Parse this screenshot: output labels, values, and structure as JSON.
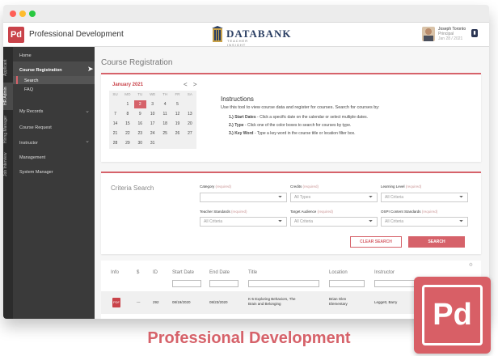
{
  "app": {
    "logo": "Pd",
    "title": "Professional Development",
    "brand": "DATABANK",
    "brand_sub": "TEACHER INSIGHT",
    "user_name": "Joseph Toronto",
    "user_role": "Principal",
    "user_sub": "Jan 28 / 2021"
  },
  "vtabs": [
    "Applicant",
    "HR Admin",
    "Hiring Manager",
    "Job Interview"
  ],
  "sidebar": {
    "items": [
      {
        "label": "Home"
      },
      {
        "label": "Course Registration"
      },
      {
        "label": "Search"
      },
      {
        "label": "FAQ"
      },
      {
        "label": "My Records"
      },
      {
        "label": "Course Request"
      },
      {
        "label": "Instructor"
      },
      {
        "label": "Management"
      },
      {
        "label": "System Manager"
      }
    ]
  },
  "main": {
    "page_title": "Course Registration",
    "calendar": {
      "month": "January 2021",
      "prev": "<",
      "next": ">",
      "days": [
        "SU",
        "MO",
        "TU",
        "WE",
        "TH",
        "FR",
        "SA"
      ],
      "weeks": [
        [
          "",
          "1",
          "2",
          "3",
          "4",
          "5",
          ""
        ],
        [
          "7",
          "8",
          "9",
          "10",
          "11",
          "12",
          "13"
        ],
        [
          "14",
          "15",
          "16",
          "17",
          "18",
          "19",
          "20"
        ],
        [
          "21",
          "22",
          "23",
          "24",
          "25",
          "26",
          "27"
        ],
        [
          "28",
          "29",
          "30",
          "31",
          "",
          "",
          ""
        ]
      ],
      "selected": "2"
    },
    "instructions": {
      "title": "Instructions",
      "text": "Use this tool to view course data and register for courses. Search for courses by:",
      "steps": [
        {
          "bold": "1.) Start Dates",
          "text": " - Click a specific date on the calendar or select multiple dates."
        },
        {
          "bold": "2.) Type",
          "text": " - Click one of the color boxes to search for courses by type."
        },
        {
          "bold": "3.) Key Word",
          "text": " - Type a key word in the course title or location filter box."
        }
      ]
    },
    "criteria": {
      "title": "Criteria Search",
      "fields": [
        {
          "label": "Category",
          "req": "(required)",
          "value": ""
        },
        {
          "label": "Credits",
          "req": "(required)",
          "value": "All Types"
        },
        {
          "label": "Learning Level",
          "req": "(required)",
          "value": "All Criteria"
        },
        {
          "label": "Teacher Standards",
          "req": "(required)",
          "value": "All Criteria"
        },
        {
          "label": "Target Audience",
          "req": "(required)",
          "value": "All Criteria"
        },
        {
          "label": "OSPI Content Standards",
          "req": "(required)",
          "value": "All Criteria"
        }
      ],
      "clear_label": "CLEAR SEARCH",
      "search_label": "SEARCH"
    },
    "table": {
      "headers": [
        "Info",
        "$",
        "ID",
        "Start Date",
        "End Date",
        "Title",
        "Location",
        "Instructor"
      ],
      "rows": [
        {
          "info": "PDF",
          "cost": "---",
          "id": "292",
          "start": "08/19/2020",
          "end": "08/23/2020",
          "title_1": "K-5 Exploring Behaviors, The",
          "title_2": "Brain and Belonging",
          "loc_1": "Brian Glen",
          "loc_2": "Elementary",
          "instructor": "Leggett, Barry"
        }
      ]
    }
  },
  "badge": {
    "label": "Pd"
  },
  "caption": "Professional Development",
  "colors": {
    "accent": "#d6626a",
    "sidebar": "#3a3a3a",
    "vtabs": "#2c2c2c"
  }
}
